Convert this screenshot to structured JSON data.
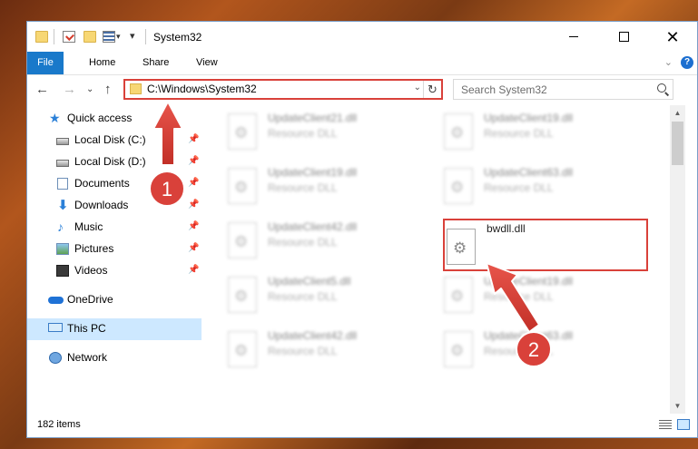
{
  "window": {
    "title": "System32"
  },
  "ribbon": {
    "tabs": [
      "File",
      "Home",
      "Share",
      "View"
    ],
    "help": "?"
  },
  "address": {
    "path": "C:\\Windows\\System32"
  },
  "search": {
    "placeholder": "Search System32"
  },
  "nav_pane": {
    "items": [
      {
        "label": "Quick access",
        "icon": "star-icon"
      },
      {
        "label": "Local Disk (C:)",
        "icon": "drive-icon",
        "pinned": true
      },
      {
        "label": "Local Disk (D:)",
        "icon": "drive-icon",
        "pinned": true
      },
      {
        "label": "Documents",
        "icon": "documents-icon",
        "pinned": true
      },
      {
        "label": "Downloads",
        "icon": "download-icon",
        "pinned": true
      },
      {
        "label": "Music",
        "icon": "music-icon",
        "pinned": true
      },
      {
        "label": "Pictures",
        "icon": "pictures-icon",
        "pinned": true
      },
      {
        "label": "Videos",
        "icon": "videos-icon",
        "pinned": true
      },
      {
        "label": "OneDrive",
        "icon": "onedrive-icon"
      },
      {
        "label": "This PC",
        "icon": "this-pc-icon",
        "selected": true
      },
      {
        "label": "Network",
        "icon": "network-icon"
      }
    ]
  },
  "files": [
    {
      "name": "UpdateClient21.dll",
      "type": "Resource DLL"
    },
    {
      "name": "UpdateClient19.dll",
      "type": "Resource DLL"
    },
    {
      "name": "UpdateClient19.dll",
      "type": "Resource DLL"
    },
    {
      "name": "UpdateClient63.dll",
      "type": "Resource DLL"
    },
    {
      "name": "UpdateClient42.dll",
      "type": "Resource DLL"
    },
    {
      "name": "bwdll.dll",
      "type": "",
      "highlighted": true
    },
    {
      "name": "UpdateClient5.dll",
      "type": "Resource DLL"
    },
    {
      "name": "UpdateClient19.dll",
      "type": "Resource DLL"
    },
    {
      "name": "UpdateClient42.dll",
      "type": "Resource DLL"
    },
    {
      "name": "UpdateClient63.dll",
      "type": "Resource DLL"
    }
  ],
  "status": {
    "item_count": "182 items"
  },
  "annotations": {
    "step1": "1",
    "step2": "2",
    "color": "#d9413a"
  }
}
